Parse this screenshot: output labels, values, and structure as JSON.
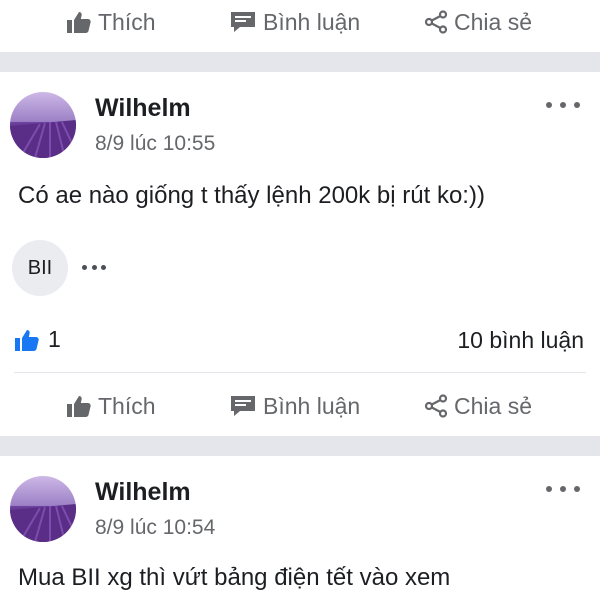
{
  "top_actions": {
    "like": "Thích",
    "comment": "Bình luận",
    "share": "Chia sẻ"
  },
  "post1": {
    "author": "Wilhelm",
    "time": "8/9 lúc 10:55",
    "text": "Có ae nào giống t thấy lệnh 200k bị rút ko:))",
    "tag": "BII",
    "like_count": "1",
    "comment_count": "10 bình luận",
    "actions": {
      "like": "Thích",
      "comment": "Bình luận",
      "share": "Chia sẻ"
    }
  },
  "post2": {
    "author": "Wilhelm",
    "time": "8/9 lúc 10:54",
    "text": "Mua BII xg thì vứt bảng điện tết vào xem"
  },
  "colors": {
    "like_blue": "#1877f2",
    "muted": "#65676b",
    "separator": "#e4e6eb"
  },
  "icons": [
    "thumbs-up-icon",
    "comment-icon",
    "share-icon",
    "more-dots-icon",
    "like-badge-icon"
  ]
}
